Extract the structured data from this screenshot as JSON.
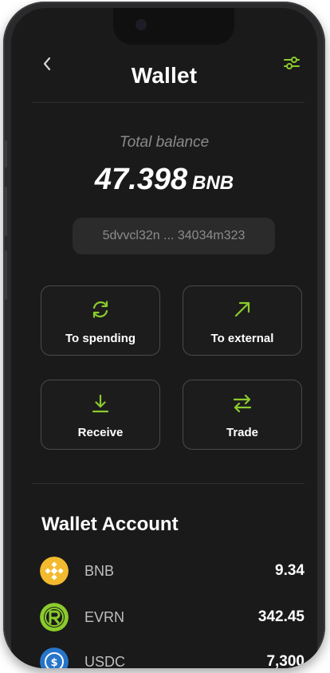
{
  "header": {
    "title": "Wallet"
  },
  "balance": {
    "label": "Total balance",
    "amount": "47.398",
    "unit": "BNB"
  },
  "wallet": {
    "address": "5dvvcl32n ... 34034m323"
  },
  "actions": [
    {
      "label": "To spending",
      "icon": "refresh-icon"
    },
    {
      "label": "To external",
      "icon": "arrow-up-right-icon"
    },
    {
      "label": "Receive",
      "icon": "download-icon"
    },
    {
      "label": "Trade",
      "icon": "swap-arrows-icon"
    }
  ],
  "account": {
    "title": "Wallet Account",
    "assets": [
      {
        "name": "BNB",
        "amount": "9.34",
        "icon": "bnb-coin-icon",
        "color": "#F3BA2F"
      },
      {
        "name": "EVRN",
        "amount": "342.45",
        "icon": "evrn-coin-icon",
        "color": "#8BCB2C"
      },
      {
        "name": "USDC",
        "amount": "7,300",
        "icon": "usdc-coin-icon",
        "color": "#2775CA"
      }
    ]
  },
  "colors": {
    "background": "#1a1a1a",
    "accent": "#8BCB2C",
    "card_border": "#4a4a4a",
    "muted_text": "#8a8a8a"
  }
}
